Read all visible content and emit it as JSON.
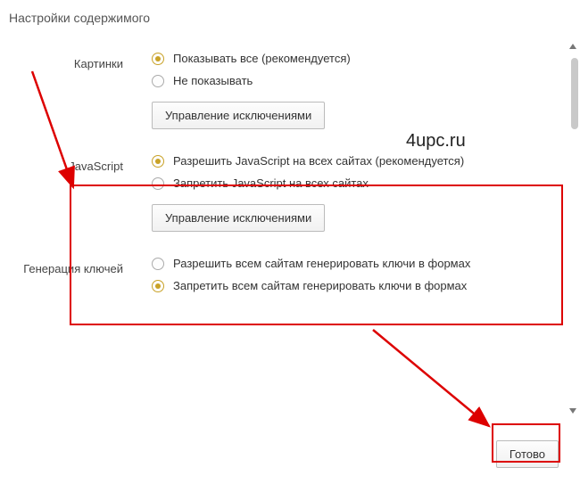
{
  "dialog": {
    "title": "Настройки содержимого"
  },
  "watermark": "4upc.ru",
  "sections": {
    "images": {
      "label": "Картинки",
      "opt1": "Показывать все (рекомендуется)",
      "opt2": "Не показывать",
      "manage": "Управление исключениями"
    },
    "javascript": {
      "label": "JavaScript",
      "opt1": "Разрешить JavaScript на всех сайтах (рекомендуется)",
      "opt2": "Запретить JavaScript на всех сайтах",
      "manage": "Управление исключениями"
    },
    "keygen": {
      "label": "Генерация ключей",
      "opt1": "Разрешить всем сайтам генерировать ключи в формах",
      "opt2": "Запретить всем сайтам генерировать ключи в формах"
    }
  },
  "done": "Готово"
}
